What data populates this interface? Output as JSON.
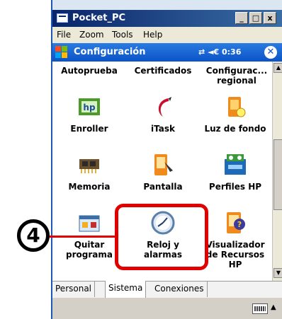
{
  "window": {
    "title": "Pocket_PC",
    "buttons": [
      "_",
      "□",
      "x"
    ]
  },
  "menu": {
    "items": [
      "File",
      "Zoom",
      "Tools",
      "Help"
    ]
  },
  "appbar": {
    "title": "Configuración",
    "status": "⇄ ◄€ 0:36",
    "ok_label": "✕"
  },
  "toprow": [
    {
      "label": "Autoprueba"
    },
    {
      "label": "Certificados"
    },
    {
      "label": "Configurac...\nregional"
    }
  ],
  "grid": [
    {
      "label": "Enroller",
      "icon": "enroller-icon"
    },
    {
      "label": "iTask",
      "icon": "itask-icon"
    },
    {
      "label": "Luz de fondo",
      "icon": "backlight-icon"
    },
    {
      "label": "Memoria",
      "icon": "memory-icon"
    },
    {
      "label": "Pantalla",
      "icon": "screen-icon"
    },
    {
      "label": "Perfiles HP",
      "icon": "hp-profiles-icon"
    },
    {
      "label": "Quitar\nprograma",
      "icon": "remove-programs-icon"
    },
    {
      "label": "Reloj y\nalarmas",
      "icon": "clock-alarms-icon"
    },
    {
      "label": "Visualizador\nde Recursos\nHP",
      "icon": "resource-viewer-icon"
    }
  ],
  "tabs": [
    "Personal",
    "Sistema",
    "Conexiones"
  ],
  "active_tab": "Sistema",
  "callout": {
    "number": "4"
  },
  "colors": {
    "highlight": "#e00000",
    "appbar": "#0a53c8",
    "titlebar": "#0a246a"
  }
}
